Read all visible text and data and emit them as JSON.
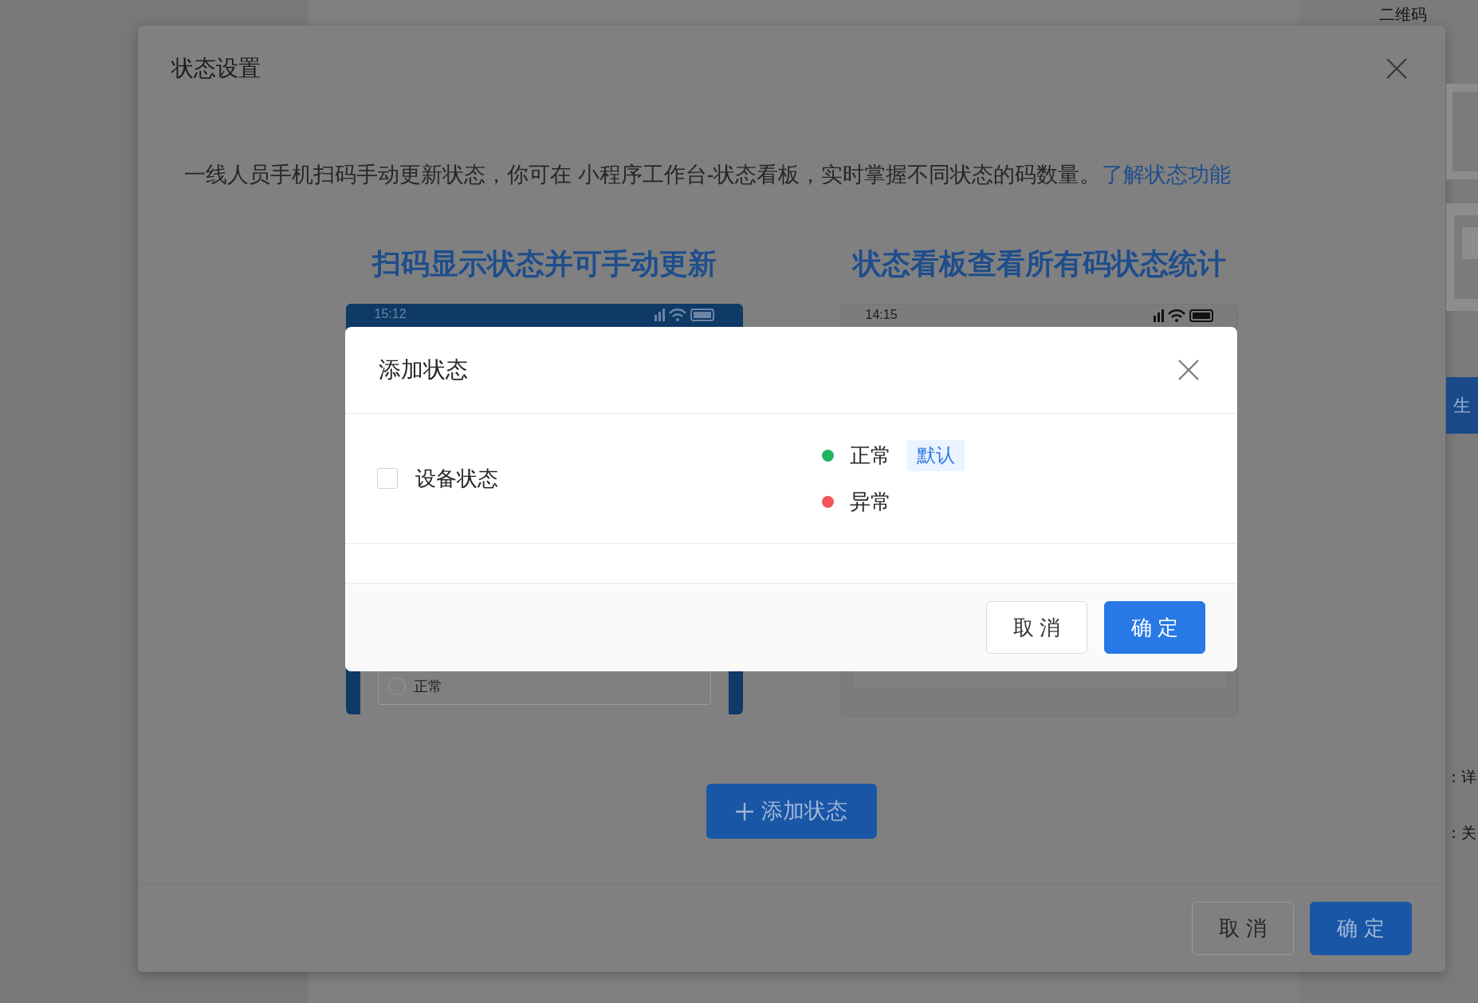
{
  "background_page": {
    "heading": "二维码",
    "button": "生",
    "lines": [
      "：详",
      "：关"
    ]
  },
  "settings_dialog": {
    "title": "状态设置",
    "description": "一线人员手机扫码手动更新状态，你可在 小程序工作台-状态看板，实时掌握不同状态的码数量。",
    "link": "了解状态功能",
    "previews": [
      {
        "kind": "scan",
        "heading": "扫码显示状态并可手动更新",
        "time": "15:12",
        "option": {
          "label": "正常",
          "selected": false
        }
      },
      {
        "kind": "board",
        "heading": "状态看板查看所有码状态统计",
        "time": "14:15"
      }
    ],
    "add_button": "添加状态",
    "buttons": [
      {
        "kind": "secondary",
        "label": "取 消"
      },
      {
        "kind": "primary",
        "label": "确 定"
      }
    ]
  },
  "add_status_dialog": {
    "title": "添加状态",
    "groups": [
      {
        "label": "设备状态",
        "checked": false,
        "statuses": [
          {
            "label": "正常",
            "color": "#22b35e",
            "tag": "默认"
          },
          {
            "label": "异常",
            "color": "#f5545a"
          }
        ]
      }
    ],
    "buttons": [
      {
        "kind": "secondary",
        "label": "取 消"
      },
      {
        "kind": "primary",
        "label": "确 定"
      }
    ]
  }
}
